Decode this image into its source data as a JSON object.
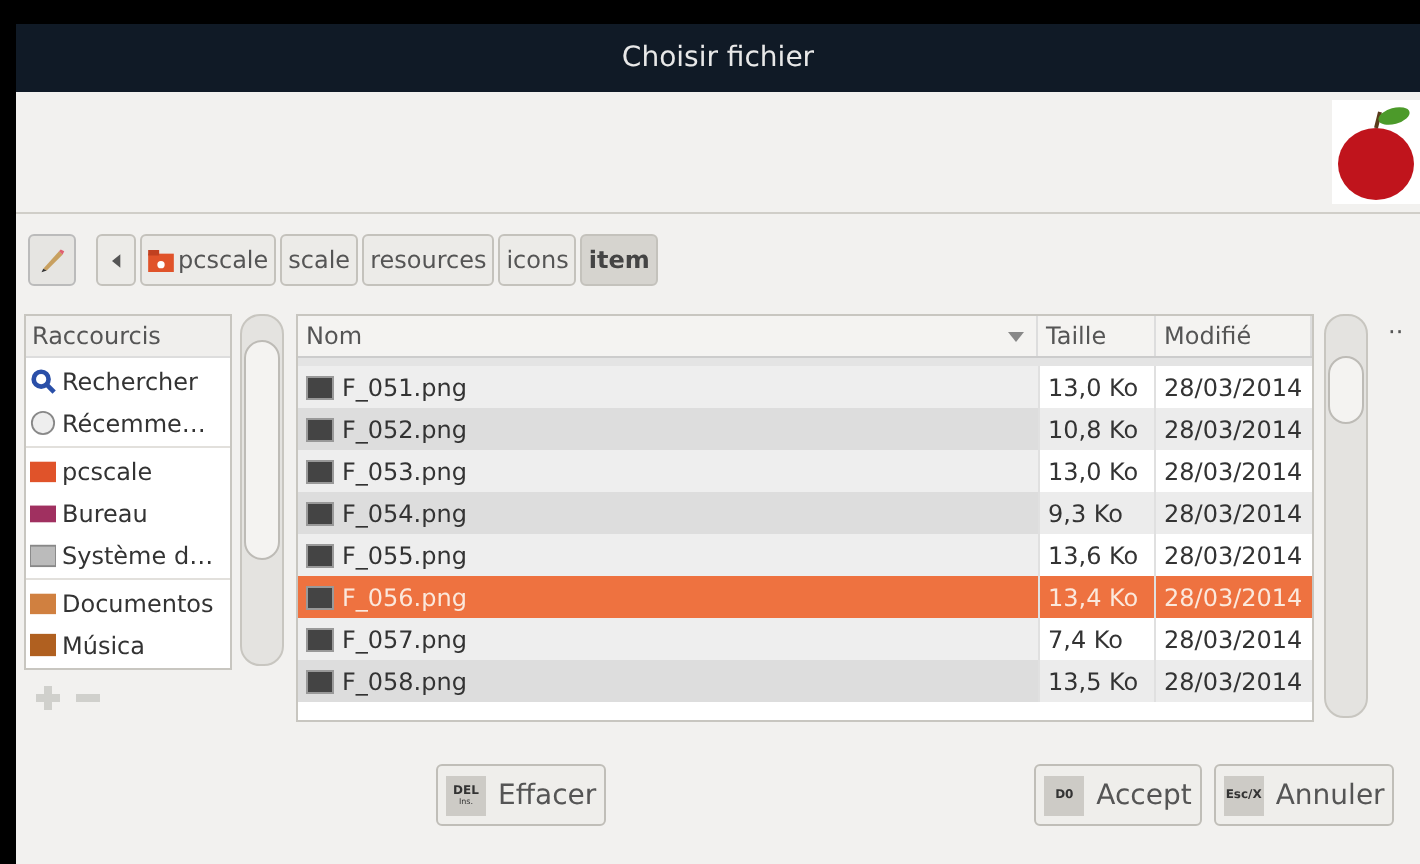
{
  "window": {
    "title": "Choisir fichier"
  },
  "path_bar": {
    "segments": [
      {
        "label": "pcscale",
        "home": true,
        "selected": false
      },
      {
        "label": "scale",
        "home": false,
        "selected": false
      },
      {
        "label": "resources",
        "home": false,
        "selected": false
      },
      {
        "label": "icons",
        "home": false,
        "selected": false
      },
      {
        "label": "item",
        "home": false,
        "selected": true
      }
    ]
  },
  "sidebar": {
    "header": "Raccourcis",
    "groups": [
      [
        {
          "label": "Rechercher",
          "kind": "search"
        },
        {
          "label": "Récemme…",
          "kind": "recent"
        }
      ],
      [
        {
          "label": "pcscale",
          "kind": "home"
        },
        {
          "label": "Bureau",
          "kind": "desktop"
        },
        {
          "label": "Système d…",
          "kind": "drive"
        }
      ],
      [
        {
          "label": "Documentos",
          "kind": "documents"
        },
        {
          "label": "Música",
          "kind": "music"
        }
      ]
    ]
  },
  "table": {
    "columns": [
      "Nom",
      "Taille",
      "Modifié"
    ],
    "rows": [
      {
        "name": "F_051.png",
        "size": "13,0 Ko",
        "modified": "28/03/2014",
        "selected": false
      },
      {
        "name": "F_052.png",
        "size": "10,8 Ko",
        "modified": "28/03/2014",
        "selected": false
      },
      {
        "name": "F_053.png",
        "size": "13,0 Ko",
        "modified": "28/03/2014",
        "selected": false
      },
      {
        "name": "F_054.png",
        "size": "9,3 Ko",
        "modified": "28/03/2014",
        "selected": false
      },
      {
        "name": "F_055.png",
        "size": "13,6 Ko",
        "modified": "28/03/2014",
        "selected": false
      },
      {
        "name": "F_056.png",
        "size": "13,4 Ko",
        "modified": "28/03/2014",
        "selected": true
      },
      {
        "name": "F_057.png",
        "size": "7,4 Ko",
        "modified": "28/03/2014",
        "selected": false
      },
      {
        "name": "F_058.png",
        "size": "13,5 Ko",
        "modified": "28/03/2014",
        "selected": false
      }
    ]
  },
  "more": "··",
  "buttons": [
    {
      "label": "Effacer",
      "key": "DEL",
      "sub": "Ins."
    },
    {
      "label": "Accept",
      "key": "D0"
    },
    {
      "label": "Annuler",
      "key": "Esc/X"
    }
  ]
}
